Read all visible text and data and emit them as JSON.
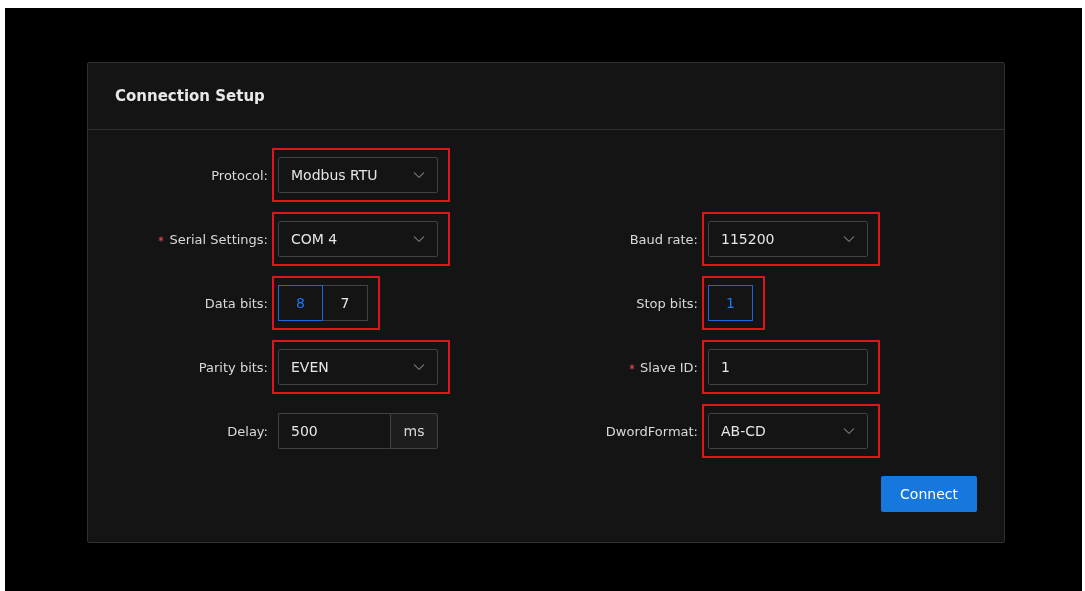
{
  "card": {
    "title": "Connection Setup"
  },
  "rows": [
    {
      "left": {
        "label": "Protocol:",
        "required": false,
        "kind": "select",
        "value": "Modbus RTU",
        "highlighted": true
      }
    },
    {
      "left": {
        "label": "Serial Settings:",
        "required": true,
        "kind": "select",
        "value": "COM 4",
        "highlighted": true
      },
      "right": {
        "label": "Baud rate:",
        "required": false,
        "kind": "select",
        "value": "115200",
        "highlighted": true
      }
    },
    {
      "left": {
        "label": "Data bits:",
        "required": false,
        "kind": "radio",
        "options": [
          {
            "label": "8",
            "selected": true
          },
          {
            "label": "7",
            "selected": false
          }
        ],
        "highlighted": true
      },
      "right": {
        "label": "Stop bits:",
        "required": false,
        "kind": "radio",
        "options": [
          {
            "label": "1",
            "selected": true
          }
        ],
        "highlighted": true
      }
    },
    {
      "left": {
        "label": "Parity bits:",
        "required": false,
        "kind": "select",
        "value": "EVEN",
        "highlighted": true
      },
      "right": {
        "label": "Slave ID:",
        "required": true,
        "kind": "input",
        "value": "1",
        "highlighted": true
      }
    },
    {
      "left": {
        "label": "Delay:",
        "required": false,
        "kind": "addon",
        "value": "500",
        "addon": "ms",
        "highlighted": false
      },
      "right": {
        "label": "DwordFormat:",
        "required": false,
        "kind": "select",
        "value": "AB-CD",
        "highlighted": true
      }
    }
  ],
  "button": {
    "label": "Connect"
  }
}
